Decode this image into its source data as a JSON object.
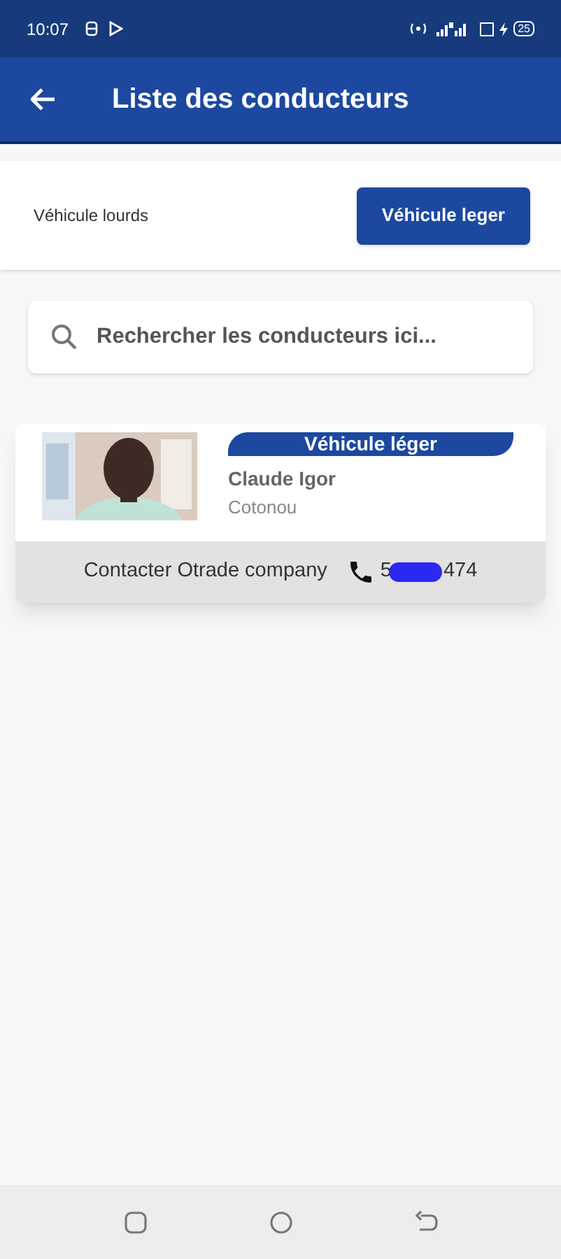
{
  "status_bar": {
    "time": "10:07",
    "battery": "25"
  },
  "app_bar": {
    "title": "Liste des conducteurs"
  },
  "tabs": [
    {
      "label": "Véhicule lourds",
      "selected": false
    },
    {
      "label": "Véhicule leger",
      "selected": true
    }
  ],
  "search": {
    "placeholder": "Rechercher les conducteurs ici..."
  },
  "drivers": [
    {
      "badge": "Véhicule léger",
      "name": "Claude Igor",
      "city": "Cotonou",
      "contact_label": "Contacter Otrade company",
      "phone_start": "5",
      "phone_end": "474"
    }
  ]
}
